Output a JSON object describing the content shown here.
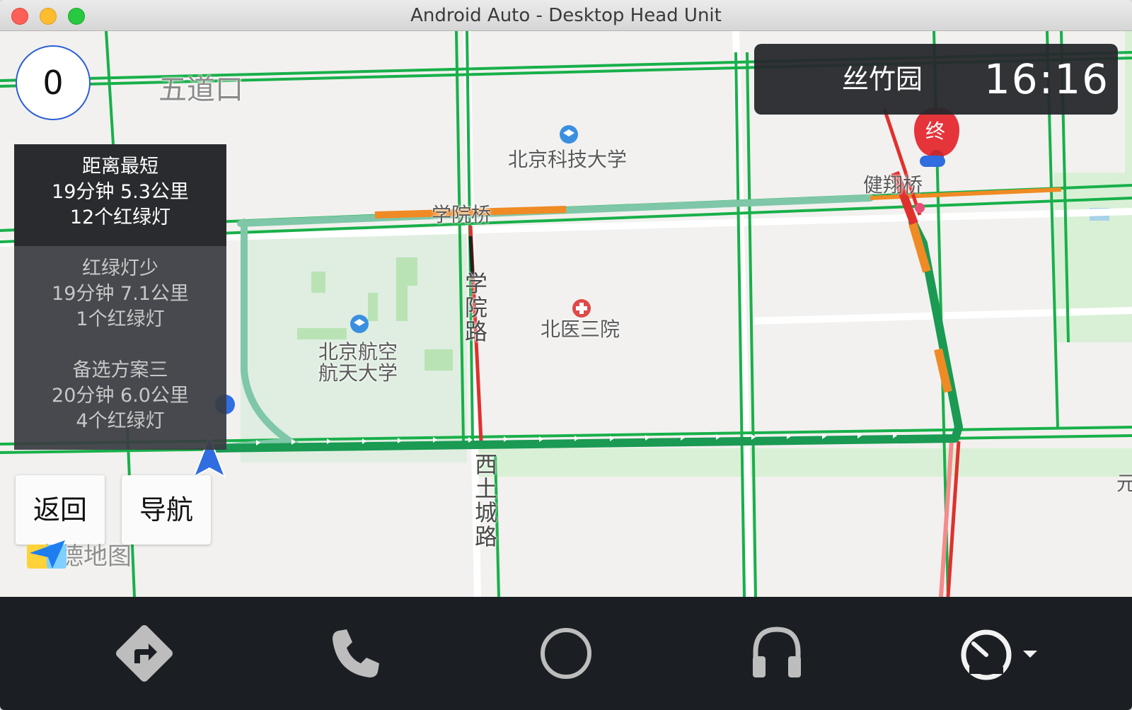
{
  "window": {
    "title": "Android Auto - Desktop Head Unit"
  },
  "map": {
    "speed": "0",
    "labels": {
      "wudaokou": "五道口",
      "ustb": "北京科技大学",
      "xueyuanqiao": "学院桥",
      "xueyuanlu": "学院路",
      "beihang": "北京航空\n航天大学",
      "beihang_line1": "北京航空",
      "beihang_line2": "航天大学",
      "beiyisanyuan": "北医三院",
      "xitucheng": "西土城路",
      "jianxiangqiao": "健翔桥",
      "end_marker": "终",
      "edge_label": "元"
    },
    "route_colors": {
      "primary": "#1a9a52",
      "congested": "#f08a24",
      "jammed": "#e0302e",
      "alt": "#7fc7a8"
    }
  },
  "routes": [
    {
      "name": "距离最短",
      "summary": "19分钟  5.3公里",
      "lights": "12个红绿灯",
      "selected": true
    },
    {
      "name": "红绿灯少",
      "summary": "19分钟  7.1公里",
      "lights": "1个红绿灯",
      "selected": false
    },
    {
      "name": "备选方案三",
      "summary": "20分钟  6.0公里",
      "lights": "4个红绿灯",
      "selected": false
    }
  ],
  "buttons": {
    "back": "返回",
    "navigate": "导航"
  },
  "brand": {
    "logo_text": "高德地图"
  },
  "destination": {
    "name": "丝竹园",
    "time": "16:16"
  },
  "navbar": {
    "items": [
      {
        "icon": "directions-icon"
      },
      {
        "icon": "phone-icon"
      },
      {
        "icon": "home-circle-icon"
      },
      {
        "icon": "headphones-icon"
      },
      {
        "icon": "speedometer-icon"
      }
    ]
  }
}
